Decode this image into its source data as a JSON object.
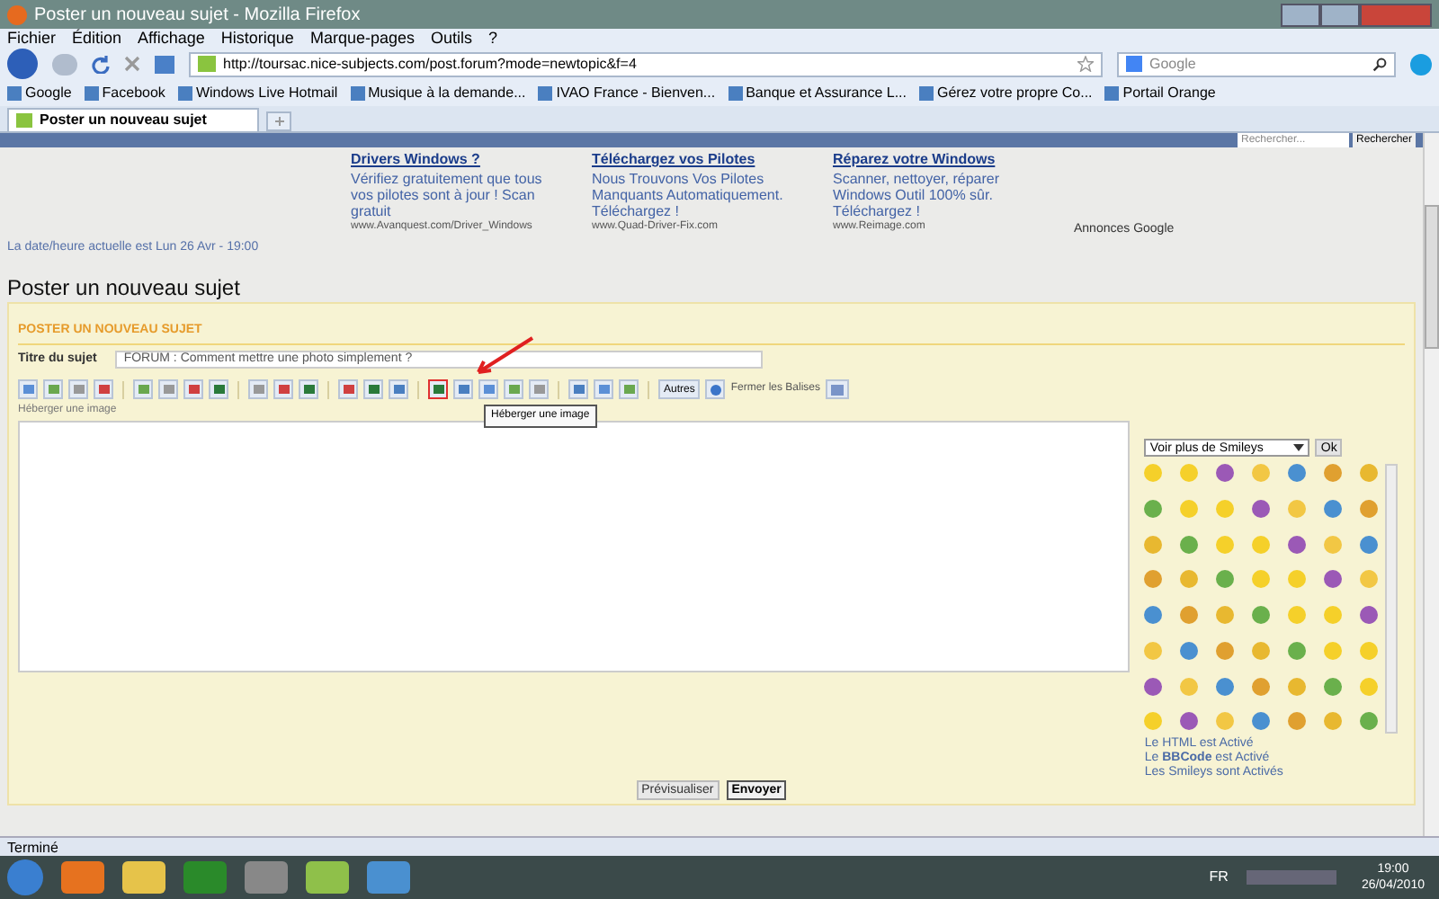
{
  "window": {
    "title": "Poster un nouveau sujet - Mozilla Firefox"
  },
  "menu": [
    "Fichier",
    "Édition",
    "Affichage",
    "Historique",
    "Marque-pages",
    "Outils",
    "?"
  ],
  "address": {
    "value": "http://toursac.nice-subjects.com/post.forum?mode=newtopic&f=4"
  },
  "web_search": {
    "placeholder": "Google"
  },
  "bookmarks": [
    {
      "label": "Google"
    },
    {
      "label": "Facebook"
    },
    {
      "label": "Windows Live Hotmail"
    },
    {
      "label": "Musique à la demande..."
    },
    {
      "label": "IVAO France - Bienven..."
    },
    {
      "label": "Banque et Assurance L..."
    },
    {
      "label": "Gérez votre propre Co..."
    },
    {
      "label": "Portail Orange"
    }
  ],
  "tabs": [
    {
      "label": "Poster un nouveau sujet",
      "selected": true
    }
  ],
  "forum_search": {
    "placeholder": "Rechercher...",
    "button": "Rechercher"
  },
  "ads": [
    {
      "title": "Drivers Windows ?",
      "text": "Vérifiez gratuitement que tous vos pilotes sont à jour ! Scan gratuit",
      "url": "www.Avanquest.com/Driver_Windows"
    },
    {
      "title": "Téléchargez vos Pilotes",
      "text": "Nous Trouvons Vos Pilotes Manquants Automatiquement. Téléchargez !",
      "url": "www.Quad-Driver-Fix.com"
    },
    {
      "title": "Réparez votre Windows",
      "text": "Scanner, nettoyer, réparer Windows Outil 100% sûr. Téléchargez !",
      "url": "www.Reimage.com"
    }
  ],
  "ads_label": "Annonces Google",
  "date_line": "La date/heure actuelle est Lun 26 Avr - 19:00",
  "page_title": "Poster un nouveau sujet",
  "form": {
    "header": "POSTER UN NOUVEAU SUJET",
    "subject_label": "Titre du sujet",
    "subject_value": "FORUM : Comment mettre une photo simplement ?",
    "tool_groups": [
      [
        {
          "highlighted": false
        },
        {
          "highlighted": false
        },
        {
          "highlighted": false
        },
        {
          "highlighted": false
        }
      ],
      [
        {
          "highlighted": false
        },
        {
          "highlighted": false
        },
        {
          "highlighted": false
        },
        {
          "highlighted": false
        }
      ],
      [
        {
          "highlighted": false
        },
        {
          "highlighted": false
        },
        {
          "highlighted": false
        }
      ],
      [
        {
          "highlighted": false
        },
        {
          "highlighted": false
        },
        {
          "highlighted": false
        }
      ],
      [
        {
          "highlighted": true
        },
        {
          "highlighted": false
        },
        {
          "highlighted": false
        },
        {
          "highlighted": false
        },
        {
          "highlighted": false
        }
      ],
      [
        {
          "highlighted": false
        },
        {
          "highlighted": false
        },
        {
          "highlighted": false
        }
      ]
    ],
    "other_button": "Autres",
    "close_tags": "Fermer les Balises",
    "hint": "Héberger une image",
    "tooltip": "Héberger une image",
    "smiley_select": "Voir plus de Smileys",
    "smiley_ok": "Ok",
    "status_lines": [
      "Le HTML est Activé",
      "Le **BBCode** est Activé",
      "Les Smileys sont Activés"
    ],
    "buttons": [
      {
        "label": "Prévisualiser",
        "primary": false
      },
      {
        "label": "Envoyer",
        "primary": true
      }
    ]
  },
  "status_bar": "Terminé",
  "taskbar": {
    "language": "FR",
    "time": "19:00",
    "date": "26/04/2010"
  }
}
